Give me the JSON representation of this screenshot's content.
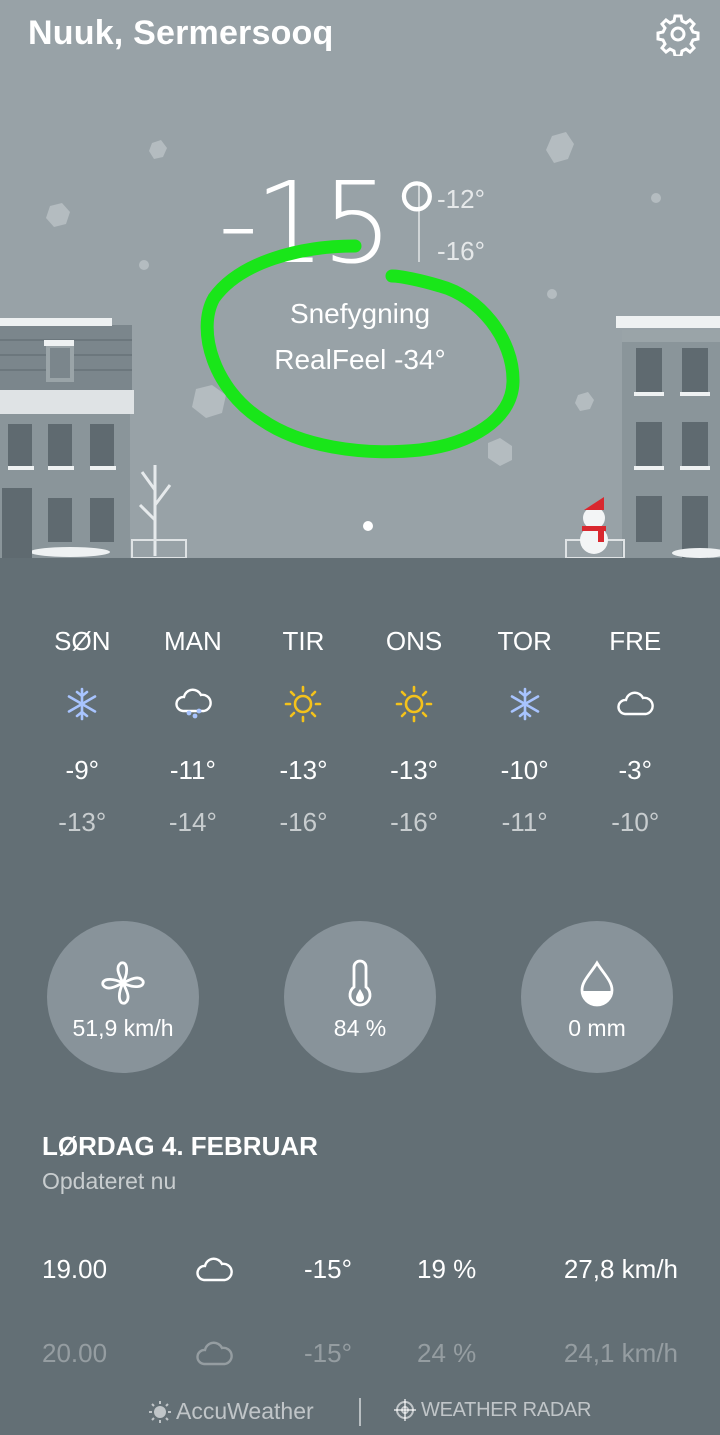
{
  "header": {
    "location": "Nuuk, Sermersooq",
    "settings_icon": "gear-icon"
  },
  "current": {
    "temp": "-15°",
    "high": "-12°",
    "low": "-16°",
    "condition": "Snefygning",
    "realfeel": "RealFeel -34°"
  },
  "forecast": [
    {
      "day": "SØN",
      "icon": "snowflake-icon",
      "high": "-9°",
      "low": "-13°"
    },
    {
      "day": "MAN",
      "icon": "cloud-snow-icon",
      "high": "-11°",
      "low": "-14°"
    },
    {
      "day": "TIR",
      "icon": "sun-icon",
      "high": "-13°",
      "low": "-16°"
    },
    {
      "day": "ONS",
      "icon": "sun-icon",
      "high": "-13°",
      "low": "-16°"
    },
    {
      "day": "TOR",
      "icon": "snowflake-icon",
      "high": "-10°",
      "low": "-11°"
    },
    {
      "day": "FRE",
      "icon": "cloud-icon",
      "high": "-3°",
      "low": "-10°"
    }
  ],
  "stats": {
    "wind": "51,9 km/h",
    "humidity": "84 %",
    "precipitation": "0 mm"
  },
  "detail": {
    "date": "LØRDAG 4. FEBRUAR",
    "updated": "Opdateret nu",
    "hours": [
      {
        "time": "19.00",
        "icon": "cloud-icon",
        "temp": "-15°",
        "humidity": "19 %",
        "wind": "27,8 km/h"
      },
      {
        "time": "20.00",
        "icon": "cloud-icon",
        "temp": "-15°",
        "humidity": "24 %",
        "wind": "24,1 km/h"
      }
    ]
  },
  "footer": {
    "provider": "AccuWeather",
    "radar": "WEATHER RADAR"
  },
  "colors": {
    "hero_bg": "#98a2a7",
    "panel_bg": "#636f75",
    "stat_bg": "#88939a",
    "sun": "#f4c21b",
    "snow": "#a8c4ff",
    "annotation": "#19e619"
  }
}
